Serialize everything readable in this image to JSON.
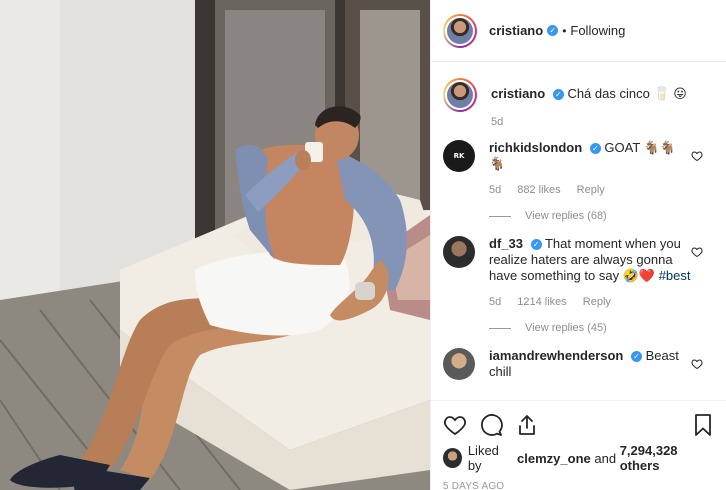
{
  "header": {
    "username": "cristiano",
    "verified_icon": "verified-badge-icon",
    "separator": "•",
    "follow_status": "Following"
  },
  "caption": {
    "username": "cristiano",
    "text": "Chá das cinco",
    "emoji": "🥛 😛",
    "age": "5d"
  },
  "comments": [
    {
      "username": "richkidslondon",
      "text": "GOAT 🐐🐐 🐐",
      "age": "5d",
      "likes": "882 likes",
      "reply_label": "Reply",
      "replies_label": "View replies (68)"
    },
    {
      "username": "df_33",
      "text": "That moment when you realize haters are always gonna have something to say 🤣❤️",
      "hashtag": "#best",
      "age": "5d",
      "likes": "1214 likes",
      "reply_label": "Reply",
      "replies_label": "View replies (45)"
    },
    {
      "username": "iamandrewhenderson",
      "text": "Beast chill"
    }
  ],
  "likes_line": {
    "prefix": "Liked by",
    "user": "clemzy_one",
    "middle": "and",
    "count": "7,294,328 others"
  },
  "timestamp": "5 DAYS AGO",
  "colors": {
    "verified": "#3897f0",
    "meta": "#8e8e8e",
    "text": "#262626",
    "hashtag": "#003569"
  },
  "icons": [
    "heart-icon",
    "comment-icon",
    "share-icon",
    "bookmark-icon"
  ]
}
